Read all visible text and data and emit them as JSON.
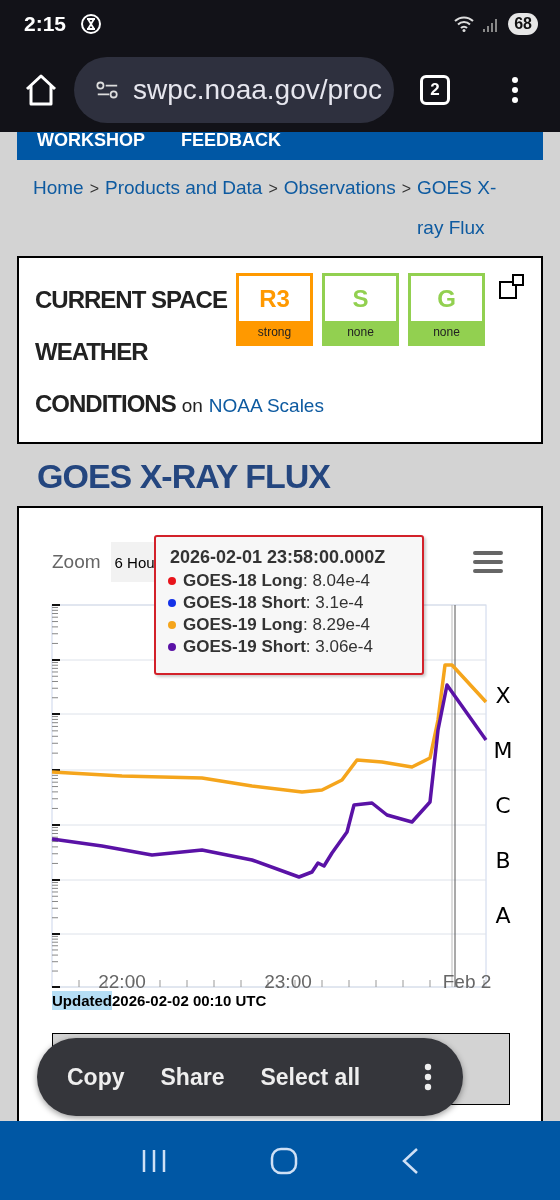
{
  "status_bar": {
    "time": "2:15",
    "battery": "68"
  },
  "browser": {
    "url": "swpc.noaa.gov/proc",
    "tab_count": "2"
  },
  "nav": [
    "WORKSHOP",
    "FEEDBACK"
  ],
  "breadcrumb": {
    "separator": ">",
    "items": [
      {
        "label": "Home"
      },
      {
        "label": "Products and Data"
      },
      {
        "label": "Observations"
      },
      {
        "label": "GOES X-ray Flux"
      }
    ]
  },
  "conditions": {
    "title_lines": [
      "CURRENT SPACE",
      "WEATHER",
      "CONDITIONS"
    ],
    "on": "on",
    "link": "NOAA Scales",
    "scales": [
      {
        "code": "R3",
        "label": "strong",
        "color": "#ff9900"
      },
      {
        "code": "S",
        "label": "none",
        "color": "#92d050"
      },
      {
        "code": "G",
        "label": "none",
        "color": "#92d050"
      }
    ]
  },
  "page_title": "GOES X-RAY FLUX",
  "chart": {
    "zoom_label": "Zoom",
    "zoom_value": "6 Hou",
    "tooltip": {
      "time": "2026-02-01 23:58:00.000Z",
      "separator": ":",
      "items": [
        {
          "name": "GOES-18 Long",
          "value": "8.04e-4",
          "color": "#e8141b"
        },
        {
          "name": "GOES-18 Short",
          "value": "3.1e-4",
          "color": "#1432e8"
        },
        {
          "name": "GOES-19 Long",
          "value": "8.29e-4",
          "color": "#f5a51c"
        },
        {
          "name": "GOES-19 Short",
          "value": "3.06e-4",
          "color": "#5a12a6"
        }
      ]
    },
    "lines": [
      {
        "color": "#f5a51c"
      },
      {
        "color": "#5a12a6"
      }
    ],
    "class_labels": [
      "X",
      "M",
      "C",
      "B",
      "A"
    ],
    "x_labels": [
      "22:00",
      "23:00",
      "Feb 2"
    ],
    "updated": {
      "label": "Updated",
      "selected": true,
      "value": "2026-02-02 00:10 UTC"
    }
  },
  "text_menu": [
    "Copy",
    "Share",
    "Select all"
  ]
}
